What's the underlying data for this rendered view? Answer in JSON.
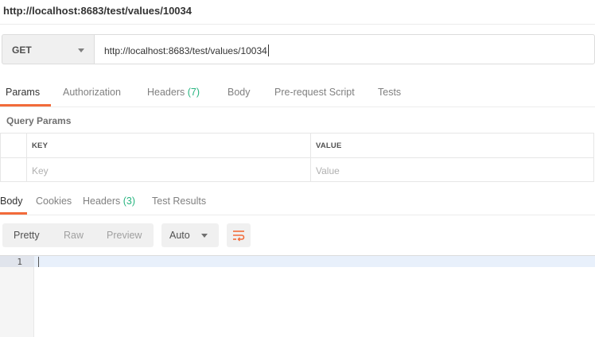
{
  "title": "http://localhost:8683/test/values/10034",
  "request": {
    "method": "GET",
    "url": "http://localhost:8683/test/values/10034"
  },
  "request_tabs": {
    "params": "Params",
    "authorization": "Authorization",
    "headers": "Headers",
    "headers_count": "(7)",
    "body": "Body",
    "prerequest": "Pre-request Script",
    "tests": "Tests"
  },
  "query_params": {
    "title": "Query Params",
    "key_header": "KEY",
    "value_header": "VALUE",
    "key_placeholder": "Key",
    "value_placeholder": "Value"
  },
  "response_tabs": {
    "body": "Body",
    "cookies": "Cookies",
    "headers": "Headers",
    "headers_count": "(3)",
    "test_results": "Test Results"
  },
  "response_toolbar": {
    "pretty": "Pretty",
    "raw": "Raw",
    "preview": "Preview",
    "format": "Auto"
  },
  "editor": {
    "line_number": "1"
  },
  "icons": {
    "method_caret": "chevron-down-icon",
    "format_caret": "chevron-down-icon",
    "wrap": "wrap-lines-icon"
  },
  "colors": {
    "accent": "#f26b3a",
    "count": "#26b47f"
  }
}
